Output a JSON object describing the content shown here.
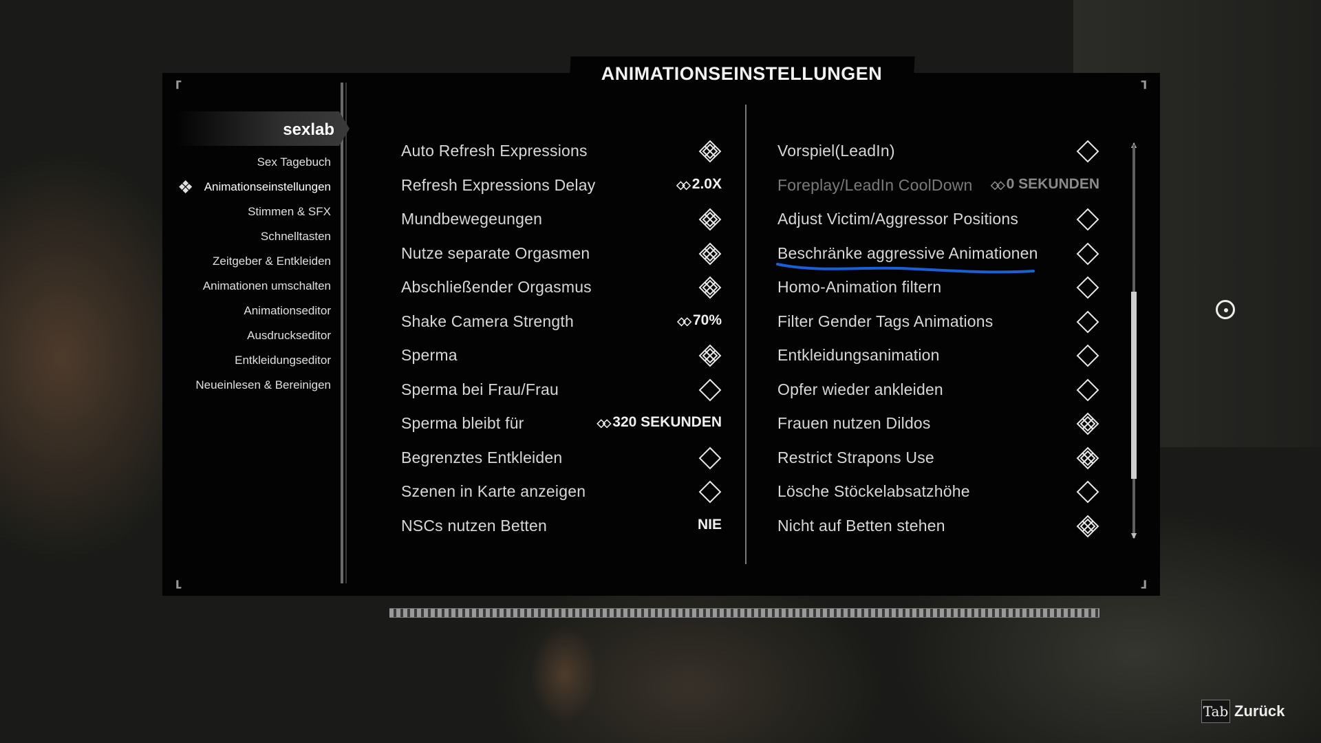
{
  "menu": {
    "title": "ANIMATIONSEINSTELLUNGEN",
    "mod_name": "sexlab"
  },
  "sidebar": {
    "items": [
      {
        "label": "Sex Tagebuch"
      },
      {
        "label": "Animationseinstellungen",
        "active": true
      },
      {
        "label": "Stimmen & SFX"
      },
      {
        "label": "Schnelltasten"
      },
      {
        "label": "Zeitgeber & Entkleiden"
      },
      {
        "label": "Animationen umschalten"
      },
      {
        "label": "Animationseditor"
      },
      {
        "label": "Ausdruckseditor"
      },
      {
        "label": "Entkleidungseditor"
      },
      {
        "label": "Neueinlesen & Bereinigen"
      }
    ]
  },
  "left_column": [
    {
      "label": "Auto Refresh Expressions",
      "type": "toggle",
      "checked": true
    },
    {
      "label": "Refresh Expressions Delay",
      "type": "slider",
      "value": "2.0X"
    },
    {
      "label": "Mundbewegeungen",
      "type": "toggle",
      "checked": true
    },
    {
      "label": "Nutze separate Orgasmen",
      "type": "toggle",
      "checked": true
    },
    {
      "label": "Abschließender Orgasmus",
      "type": "toggle",
      "checked": true
    },
    {
      "label": "Shake Camera Strength",
      "type": "slider",
      "value": "70%"
    },
    {
      "label": "Sperma",
      "type": "toggle",
      "checked": true
    },
    {
      "label": "Sperma bei Frau/Frau",
      "type": "toggle",
      "checked": false
    },
    {
      "label": "Sperma bleibt für",
      "type": "slider",
      "value": "320 SEKUNDEN"
    },
    {
      "label": "Begrenztes Entkleiden",
      "type": "toggle",
      "checked": false
    },
    {
      "label": "Szenen in Karte anzeigen",
      "type": "toggle",
      "checked": false
    },
    {
      "label": "NSCs nutzen Betten",
      "type": "menu",
      "value": "NIE"
    }
  ],
  "right_column": [
    {
      "label": "Vorspiel(LeadIn)",
      "type": "toggle",
      "checked": false
    },
    {
      "label": "Foreplay/LeadIn CoolDown",
      "type": "slider",
      "value": "0 SEKUNDEN",
      "disabled": true
    },
    {
      "label": "Adjust Victim/Aggressor Positions",
      "type": "toggle",
      "checked": false
    },
    {
      "label": "Beschränke aggressive Animationen",
      "type": "toggle",
      "checked": false,
      "highlighted": true
    },
    {
      "label": "Homo-Animation filtern",
      "type": "toggle",
      "checked": false
    },
    {
      "label": "Filter Gender Tags Animations",
      "type": "toggle",
      "checked": false
    },
    {
      "label": "Entkleidungsanimation",
      "type": "toggle",
      "checked": false
    },
    {
      "label": "Opfer wieder ankleiden",
      "type": "toggle",
      "checked": false
    },
    {
      "label": "Frauen nutzen Dildos",
      "type": "toggle",
      "checked": true
    },
    {
      "label": "Restrict Strapons Use",
      "type": "toggle",
      "checked": true
    },
    {
      "label": "Lösche Stöckelabsatzhöhe",
      "type": "toggle",
      "checked": false
    },
    {
      "label": "Nicht auf Betten stehen",
      "type": "toggle",
      "checked": true
    }
  ],
  "scrollbar": {
    "position_fraction": 0.37,
    "visible_fraction": 0.48
  },
  "footer": {
    "back_key": "Tab",
    "back_label": "Zurück"
  },
  "colors": {
    "panel_bg": "#030303",
    "text": "#d8d8d8",
    "disabled_text": "#7a7a7a",
    "highlight_underline": "#1a5fd6"
  }
}
